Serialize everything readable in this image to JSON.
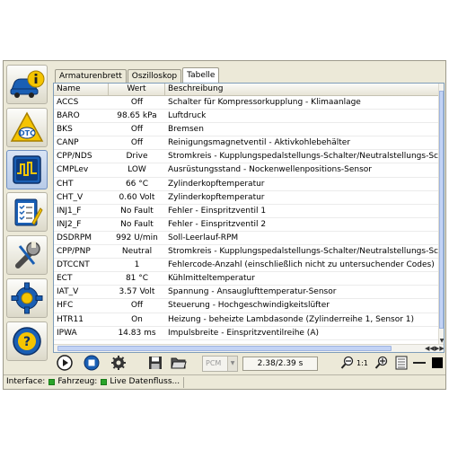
{
  "tabs": [
    "Armaturenbrett",
    "Oszilloskop",
    "Tabelle"
  ],
  "table": {
    "headers": [
      "Name",
      "Wert",
      "Beschreibung"
    ],
    "rows": [
      [
        "ACCS",
        "Off",
        "Schalter für Kompressorkupplung - Klimaanlage"
      ],
      [
        "BARO",
        "98.65 kPa",
        "Luftdruck"
      ],
      [
        "BKS",
        "Off",
        "Bremsen"
      ],
      [
        "CANP",
        "Off",
        "Reinigungsmagnetventil - Aktivkohlebehälter"
      ],
      [
        "CPP/NDS",
        "Drive",
        "Stromkreis - Kupplungspedalstellungs-Schalter/Neutralstellungs-Sc"
      ],
      [
        "CMPLev",
        "LOW",
        "Ausrüstungsstand - Nockenwellenpositions-Sensor"
      ],
      [
        "CHT",
        "66 °C",
        "Zylinderkopftemperatur"
      ],
      [
        "CHT_V",
        "0.60 Volt",
        "Zylinderkopftemperatur"
      ],
      [
        "INJ1_F",
        "No Fault",
        "Fehler - Einspritzventil 1"
      ],
      [
        "INJ2_F",
        "No Fault",
        "Fehler - Einspritzventil 2"
      ],
      [
        "DSDRPM",
        "992 U/min",
        "Soll-Leerlauf-RPM"
      ],
      [
        "CPP/PNP",
        "Neutral",
        "Stromkreis - Kupplungspedalstellungs-Schalter/Neutralstellungs-Sc"
      ],
      [
        "DTCCNT",
        "1",
        "Fehlercode-Anzahl (einschließlich nicht zu untersuchender Codes)"
      ],
      [
        "ECT",
        "81 °C",
        "Kühlmitteltemperatur"
      ],
      [
        "IAT_V",
        "3.57 Volt",
        "Spannung - Ansauglufttemperatur-Sensor"
      ],
      [
        "HFC",
        "Off",
        "Steuerung - Hochgeschwindigkeitslüfter"
      ],
      [
        "HTR11",
        "On",
        "Heizung - beheizte Lambdasonde (Zylinderreihe 1, Sensor 1)"
      ],
      [
        "IPWA",
        "14.83 ms",
        "Impulsbreite - Einspritzventilreihe (A)"
      ]
    ]
  },
  "toolbar": {
    "pcm": "PCM",
    "time": "2.38/2.39 s",
    "ratio": "1:1"
  },
  "statusbar": {
    "interface": "Interface:",
    "vehicle": "Fahrzeug:",
    "datastream": "Live Datenfluss..."
  },
  "icons": {
    "sidebar": [
      "car-info-icon",
      "dtc-icon",
      "oscilloscope-icon",
      "checklist-icon",
      "wrench-icon",
      "gear-settings-icon",
      "help-icon"
    ],
    "toolbar": [
      "play-icon",
      "stop-icon",
      "settings-icon",
      "save-icon",
      "open-folder-icon",
      "zoom-out-icon",
      "zoom-in-icon",
      "layout-single-icon",
      "layout-split-icon",
      "color-icon"
    ]
  },
  "colors": {
    "accent_blue": "#1a5fb4",
    "icon_yellow": "#f5c400",
    "status_green": "#2aa52a"
  }
}
